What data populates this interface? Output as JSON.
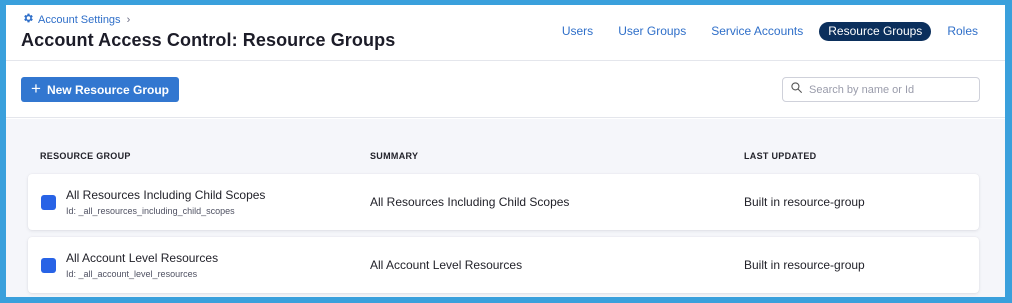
{
  "breadcrumb": {
    "icon": "gear-icon",
    "label": "Account Settings",
    "separator": "›"
  },
  "page_title": "Account Access Control: Resource Groups",
  "tabs": [
    {
      "label": "Users",
      "active": false
    },
    {
      "label": "User Groups",
      "active": false
    },
    {
      "label": "Service Accounts",
      "active": false
    },
    {
      "label": "Resource Groups",
      "active": true
    },
    {
      "label": "Roles",
      "active": false
    }
  ],
  "toolbar": {
    "new_button_label": "New Resource Group",
    "search_placeholder": "Search by name or Id"
  },
  "table": {
    "columns": [
      "RESOURCE GROUP",
      "SUMMARY",
      "LAST UPDATED"
    ],
    "rows": [
      {
        "name": "All Resources Including Child Scopes",
        "id": "Id: _all_resources_including_child_scopes",
        "summary": "All Resources Including Child Scopes",
        "last_updated": "Built in resource-group",
        "color": "#2863e6"
      },
      {
        "name": "All Account Level Resources",
        "id": "Id: _all_account_level_resources",
        "summary": "All Account Level Resources",
        "last_updated": "Built in resource-group",
        "color": "#2863e6"
      }
    ]
  },
  "colors": {
    "accent": "#3277d0",
    "active_tab": "#0b2f5c",
    "link": "#2f6fc9",
    "frame_border": "#3aa0dc"
  }
}
